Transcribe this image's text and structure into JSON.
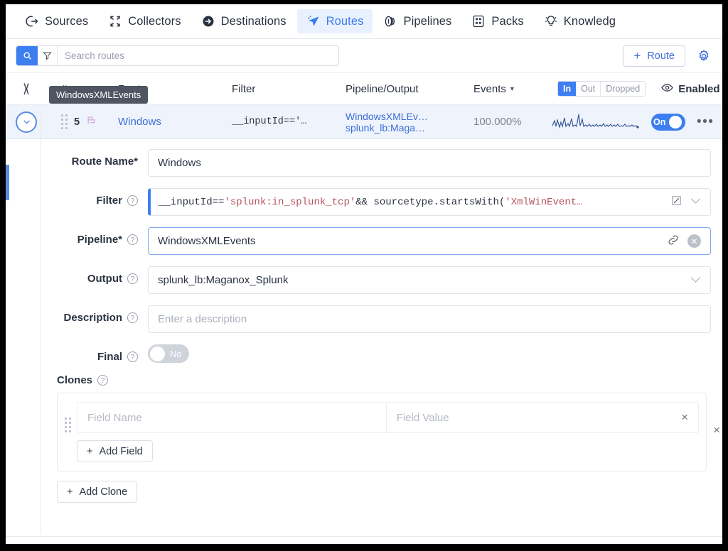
{
  "topnav": {
    "items": [
      {
        "label": "Sources",
        "icon": "sources-icon",
        "active": false
      },
      {
        "label": "Collectors",
        "icon": "collectors-icon",
        "active": false
      },
      {
        "label": "Destinations",
        "icon": "destinations-icon",
        "active": false
      },
      {
        "label": "Routes",
        "icon": "routes-icon",
        "active": true
      },
      {
        "label": "Pipelines",
        "icon": "pipelines-icon",
        "active": false
      },
      {
        "label": "Packs",
        "icon": "packs-icon",
        "active": false
      },
      {
        "label": "Knowledg",
        "icon": "knowledge-icon",
        "active": false
      }
    ]
  },
  "search": {
    "placeholder": "Search routes",
    "search_icon": "search-icon",
    "filter_icon": "filter-funnel-icon"
  },
  "toolbar": {
    "add_route_label": "Route",
    "add_route_plus": "+",
    "settings_icon": "gear-icon"
  },
  "table": {
    "tooltip": "WindowsXMLEvents",
    "headers": {
      "hash": "#",
      "route": "Route",
      "filter": "Filter",
      "pipeline_output": "Pipeline/Output",
      "events": "Events",
      "enabled": "Enabled"
    },
    "events_caret": "▾",
    "enabled_caret": "▾",
    "inout": {
      "in": "In",
      "out": "Out",
      "dropped": "Dropped",
      "selected": "In"
    },
    "row": {
      "number": "5",
      "flag_icon": "flag-icon",
      "route": "Windows",
      "filter": "__inputId=='…",
      "pipeline": "WindowsXMLEv…",
      "output": "splunk_lb:Maga…",
      "percent": "100.000%",
      "toggle_label": "On",
      "kebab": "•••"
    }
  },
  "form": {
    "route_name": {
      "label": "Route Name*",
      "value": "Windows"
    },
    "filter": {
      "label": "Filter",
      "prefix": "__inputId==",
      "str1": "'splunk:in_splunk_tcp'",
      "middle": " && sourcetype.startsWith(",
      "str2": "'XmlWinEvent…",
      "expand_icon": "expand-editor-icon",
      "chevron": "⌄"
    },
    "pipeline": {
      "label": "Pipeline*",
      "value": "WindowsXMLEvents",
      "link_icon": "link-icon",
      "clear_icon": "clear-circle-icon"
    },
    "output": {
      "label": "Output",
      "value": "splunk_lb:Maganox_Splunk",
      "chevron": "⌄"
    },
    "description": {
      "label": "Description",
      "placeholder": "Enter a description",
      "value": ""
    },
    "final": {
      "label": "Final",
      "value": "No"
    },
    "clones": {
      "label": "Clones",
      "field_name_placeholder": "Field Name",
      "field_value_placeholder": "Field Value",
      "remove_field_label": "×",
      "remove_clone_label": "×",
      "add_field_label": "Add Field",
      "add_clone_label": "Add Clone",
      "plus": "+"
    },
    "help_icon": "question-mark-icon"
  },
  "colors": {
    "accent": "#3d7ef0",
    "link": "#3d6fd6",
    "row_selected": "#eef3fc",
    "nav_active_bg": "#e9f0fe",
    "text": "#2b3342",
    "muted": "#9aa1ad",
    "string_token": "#b4525b"
  }
}
